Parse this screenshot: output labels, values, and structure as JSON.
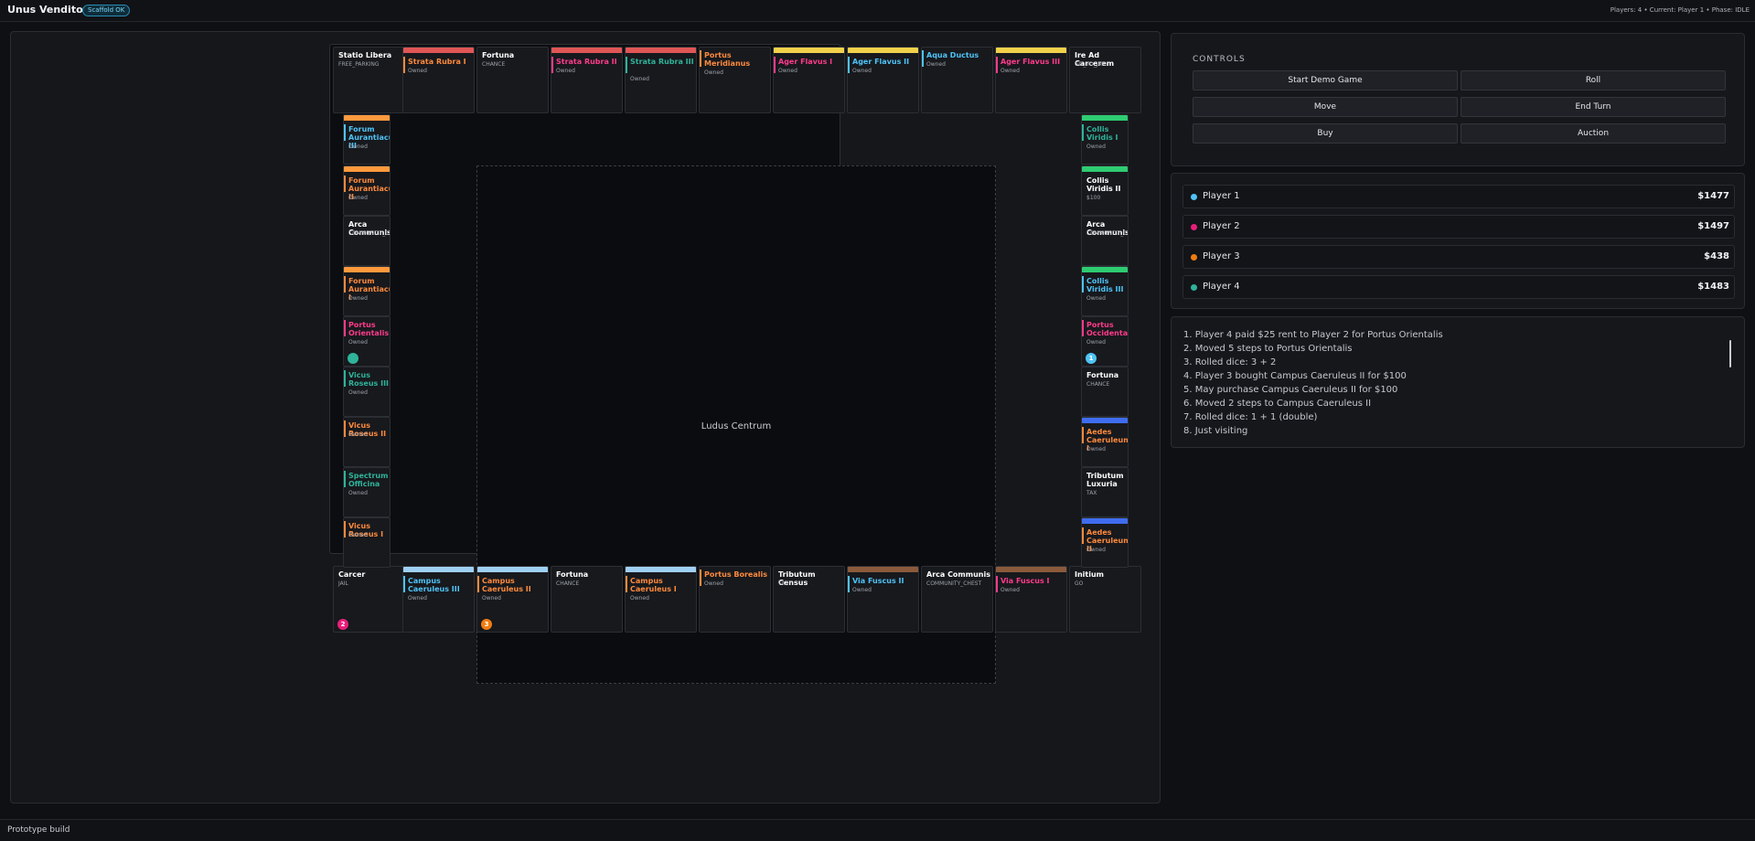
{
  "app": {
    "title": "Unus Venditor",
    "badge": "Scaffold OK",
    "status": "Players: 4 • Current: Player 1 • Phase: IDLE"
  },
  "board": {
    "center_label": "Ludus Centrum"
  },
  "tiles": {
    "top": [
      {
        "name": "Statio Libera",
        "sub": "FREE_PARKING",
        "color": "#ffffff"
      },
      {
        "name": "Strata Rubra I",
        "sub": "Owned",
        "color": "#ff8a3d",
        "group": "#e05656"
      },
      {
        "name": "Fortuna",
        "sub": "CHANCE",
        "color": "#ffffff"
      },
      {
        "name": "Strata Rubra II",
        "sub": "Owned",
        "color": "#ff3b8b",
        "group": "#e05656"
      },
      {
        "name": "Strata Rubra III",
        "sub": "Owned",
        "color": "#2fb39a",
        "group": "#e05656"
      },
      {
        "name": "Portus Meridianus",
        "sub": "Owned",
        "color": "#ff8a3d"
      },
      {
        "name": "Ager Flavus I",
        "sub": "Owned",
        "color": "#ff3b8b",
        "group": "#f2d14b"
      },
      {
        "name": "Ager Flavus II",
        "sub": "Owned",
        "color": "#4fc3f7",
        "group": "#f2d14b"
      },
      {
        "name": "Aqua Ductus",
        "sub": "Owned",
        "color": "#4fc3f7"
      },
      {
        "name": "Ager Flavus III",
        "sub": "Owned",
        "color": "#ff3b8b",
        "group": "#f2d14b"
      },
      {
        "name": "Ire Ad Carcerem",
        "sub": "GO_TO_JAIL",
        "color": "#ffffff"
      }
    ],
    "left": [
      {
        "name": "Forum Aurantiacus III",
        "sub": "Owned",
        "color": "#4fc3f7",
        "group": "#ff9a3d"
      },
      {
        "name": "Forum Aurantiacus II",
        "sub": "Owned",
        "color": "#ff8a3d",
        "group": "#ff9a3d"
      },
      {
        "name": "Arca Communis",
        "sub": "COMMUNITY_CHEST",
        "color": "#ffffff"
      },
      {
        "name": "Forum Aurantiacus I",
        "sub": "Owned",
        "color": "#ff8a3d",
        "group": "#ff9a3d"
      },
      {
        "name": "Portus Orientalis",
        "sub": "Owned",
        "color": "#ff3b8b"
      },
      {
        "name": "Vicus Roseus III",
        "sub": "Owned",
        "color": "#2fb39a"
      },
      {
        "name": "Vicus Roseus II",
        "sub": "Owned",
        "color": "#ff8a3d"
      },
      {
        "name": "Spectrum Officina",
        "sub": "Owned",
        "color": "#2fb39a"
      },
      {
        "name": "Vicus Roseus I",
        "sub": "Owned",
        "color": "#ff8a3d"
      }
    ],
    "right": [
      {
        "name": "Collis Viridis I",
        "sub": "Owned",
        "color": "#2fb39a",
        "group": "#2ecc71"
      },
      {
        "name": "Collis Viridis II",
        "sub": "$100",
        "color": "#ffffff",
        "group": "#2ecc71"
      },
      {
        "name": "Arca Communis",
        "sub": "COMMUNITY_CHEST",
        "color": "#ffffff"
      },
      {
        "name": "Collis Viridis III",
        "sub": "Owned",
        "color": "#4fc3f7",
        "group": "#2ecc71"
      },
      {
        "name": "Portus Occidentalis",
        "sub": "Owned",
        "color": "#ff3b8b"
      },
      {
        "name": "Fortuna",
        "sub": "CHANCE",
        "color": "#ffffff"
      },
      {
        "name": "Aedes Caeruleum I",
        "sub": "Owned",
        "color": "#ff8a3d",
        "group": "#3f6df0"
      },
      {
        "name": "Tributum Luxuria",
        "sub": "TAX",
        "color": "#ffffff"
      },
      {
        "name": "Aedes Caeruleum II",
        "sub": "Owned",
        "color": "#ff8a3d",
        "group": "#3f6df0"
      }
    ],
    "bottom": [
      {
        "name": "Carcer",
        "sub": "JAIL",
        "color": "#ffffff"
      },
      {
        "name": "Campus Caeruleus III",
        "sub": "Owned",
        "color": "#4fc3f7",
        "group": "#9fd0f5"
      },
      {
        "name": "Campus Caeruleus II",
        "sub": "Owned",
        "color": "#ff8a3d",
        "group": "#9fd0f5"
      },
      {
        "name": "Fortuna",
        "sub": "CHANCE",
        "color": "#ffffff"
      },
      {
        "name": "Campus Caeruleus I",
        "sub": "Owned",
        "color": "#ff8a3d",
        "group": "#9fd0f5"
      },
      {
        "name": "Portus Borealis",
        "sub": "Owned",
        "color": "#ff8a3d"
      },
      {
        "name": "Tributum Census",
        "sub": "TAX",
        "color": "#ffffff"
      },
      {
        "name": "Via Fuscus II",
        "sub": "Owned",
        "color": "#4fc3f7",
        "group": "#8b5a3c"
      },
      {
        "name": "Arca Communis",
        "sub": "COMMUNITY_CHEST",
        "color": "#ffffff"
      },
      {
        "name": "Via Fuscus I",
        "sub": "Owned",
        "color": "#ff3b8b",
        "group": "#8b5a3c"
      },
      {
        "name": "Initium",
        "sub": "GO",
        "color": "#ffffff"
      }
    ]
  },
  "tokens": [
    {
      "side": "bottom",
      "index": 0,
      "label": "2",
      "color": "#e91e7a"
    },
    {
      "side": "bottom",
      "index": 2,
      "label": "3",
      "color": "#ef7d10"
    },
    {
      "side": "left",
      "index": 4,
      "label": "",
      "color": "#2fb39a"
    },
    {
      "side": "right",
      "index": 4,
      "label": "1",
      "color": "#4fc3f7"
    }
  ],
  "controls": {
    "title": "CONTROLS",
    "buttons": [
      "Start Demo Game",
      "Roll",
      "Move",
      "End Turn",
      "Buy",
      "Auction"
    ]
  },
  "players": [
    {
      "name": "Player 1",
      "money": "$1477",
      "color": "#4fc3f7"
    },
    {
      "name": "Player 2",
      "money": "$1497",
      "color": "#e91e7a"
    },
    {
      "name": "Player 3",
      "money": "$438",
      "color": "#ef7d10"
    },
    {
      "name": "Player 4",
      "money": "$1483",
      "color": "#2fb39a"
    }
  ],
  "log": [
    "1. Player 4 paid $25 rent to Player 2 for Portus Orientalis",
    "2. Moved 5 steps to Portus Orientalis",
    "3. Rolled dice: 3 + 2",
    "4. Player 3 bought Campus Caeruleus II for $100",
    "5. May purchase Campus Caeruleus II for $100",
    "6. Moved 2 steps to Campus Caeruleus II",
    "7. Rolled dice: 1 + 1 (double)",
    "8. Just visiting"
  ],
  "footer": {
    "text": "Prototype build"
  }
}
